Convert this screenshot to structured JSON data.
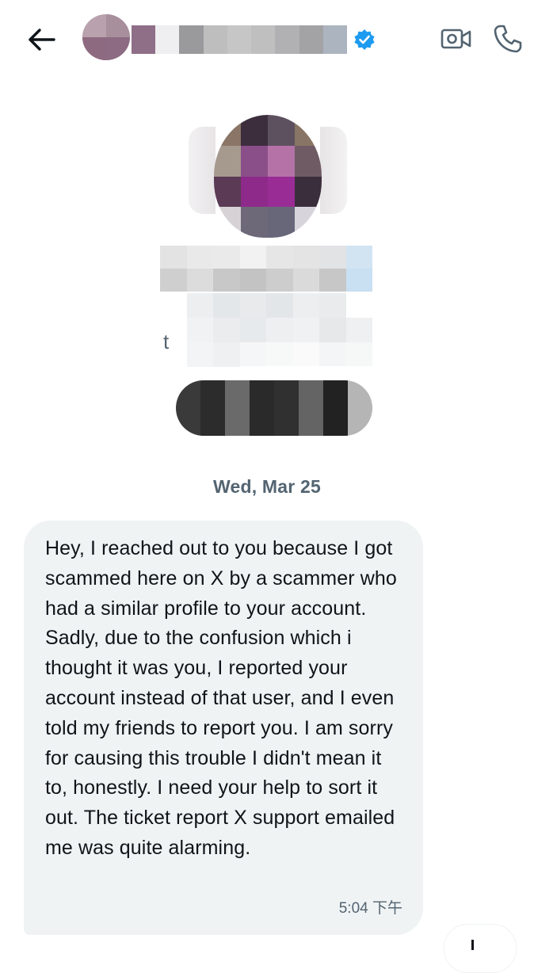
{
  "header": {
    "back_icon": "arrow-left-icon",
    "verified_icon": "verified-badge-icon",
    "verified_color": "#1d9bf0",
    "video_icon": "video-camera-icon",
    "phone_icon": "phone-icon"
  },
  "profile": {
    "handle_fragment": "t"
  },
  "conversation": {
    "date_separator": "Wed, Mar 25",
    "messages": [
      {
        "text": "Hey, I reached out to you because I got scammed here on X by a scammer who had a similar profile to your account. Sadly, due to the confusion which i thought it was you, I reported your account instead of that user, and I even told my friends to report you. I am sorry for causing this trouble I didn't mean it to, honestly. I need your help to sort it out. The ticket report X support emailed me was quite alarming.",
        "time": "5:04 下午",
        "bubble_color": "#eff3f4"
      }
    ]
  },
  "colors": {
    "text_primary": "#0f1419",
    "text_secondary": "#536471",
    "background": "#ffffff"
  }
}
